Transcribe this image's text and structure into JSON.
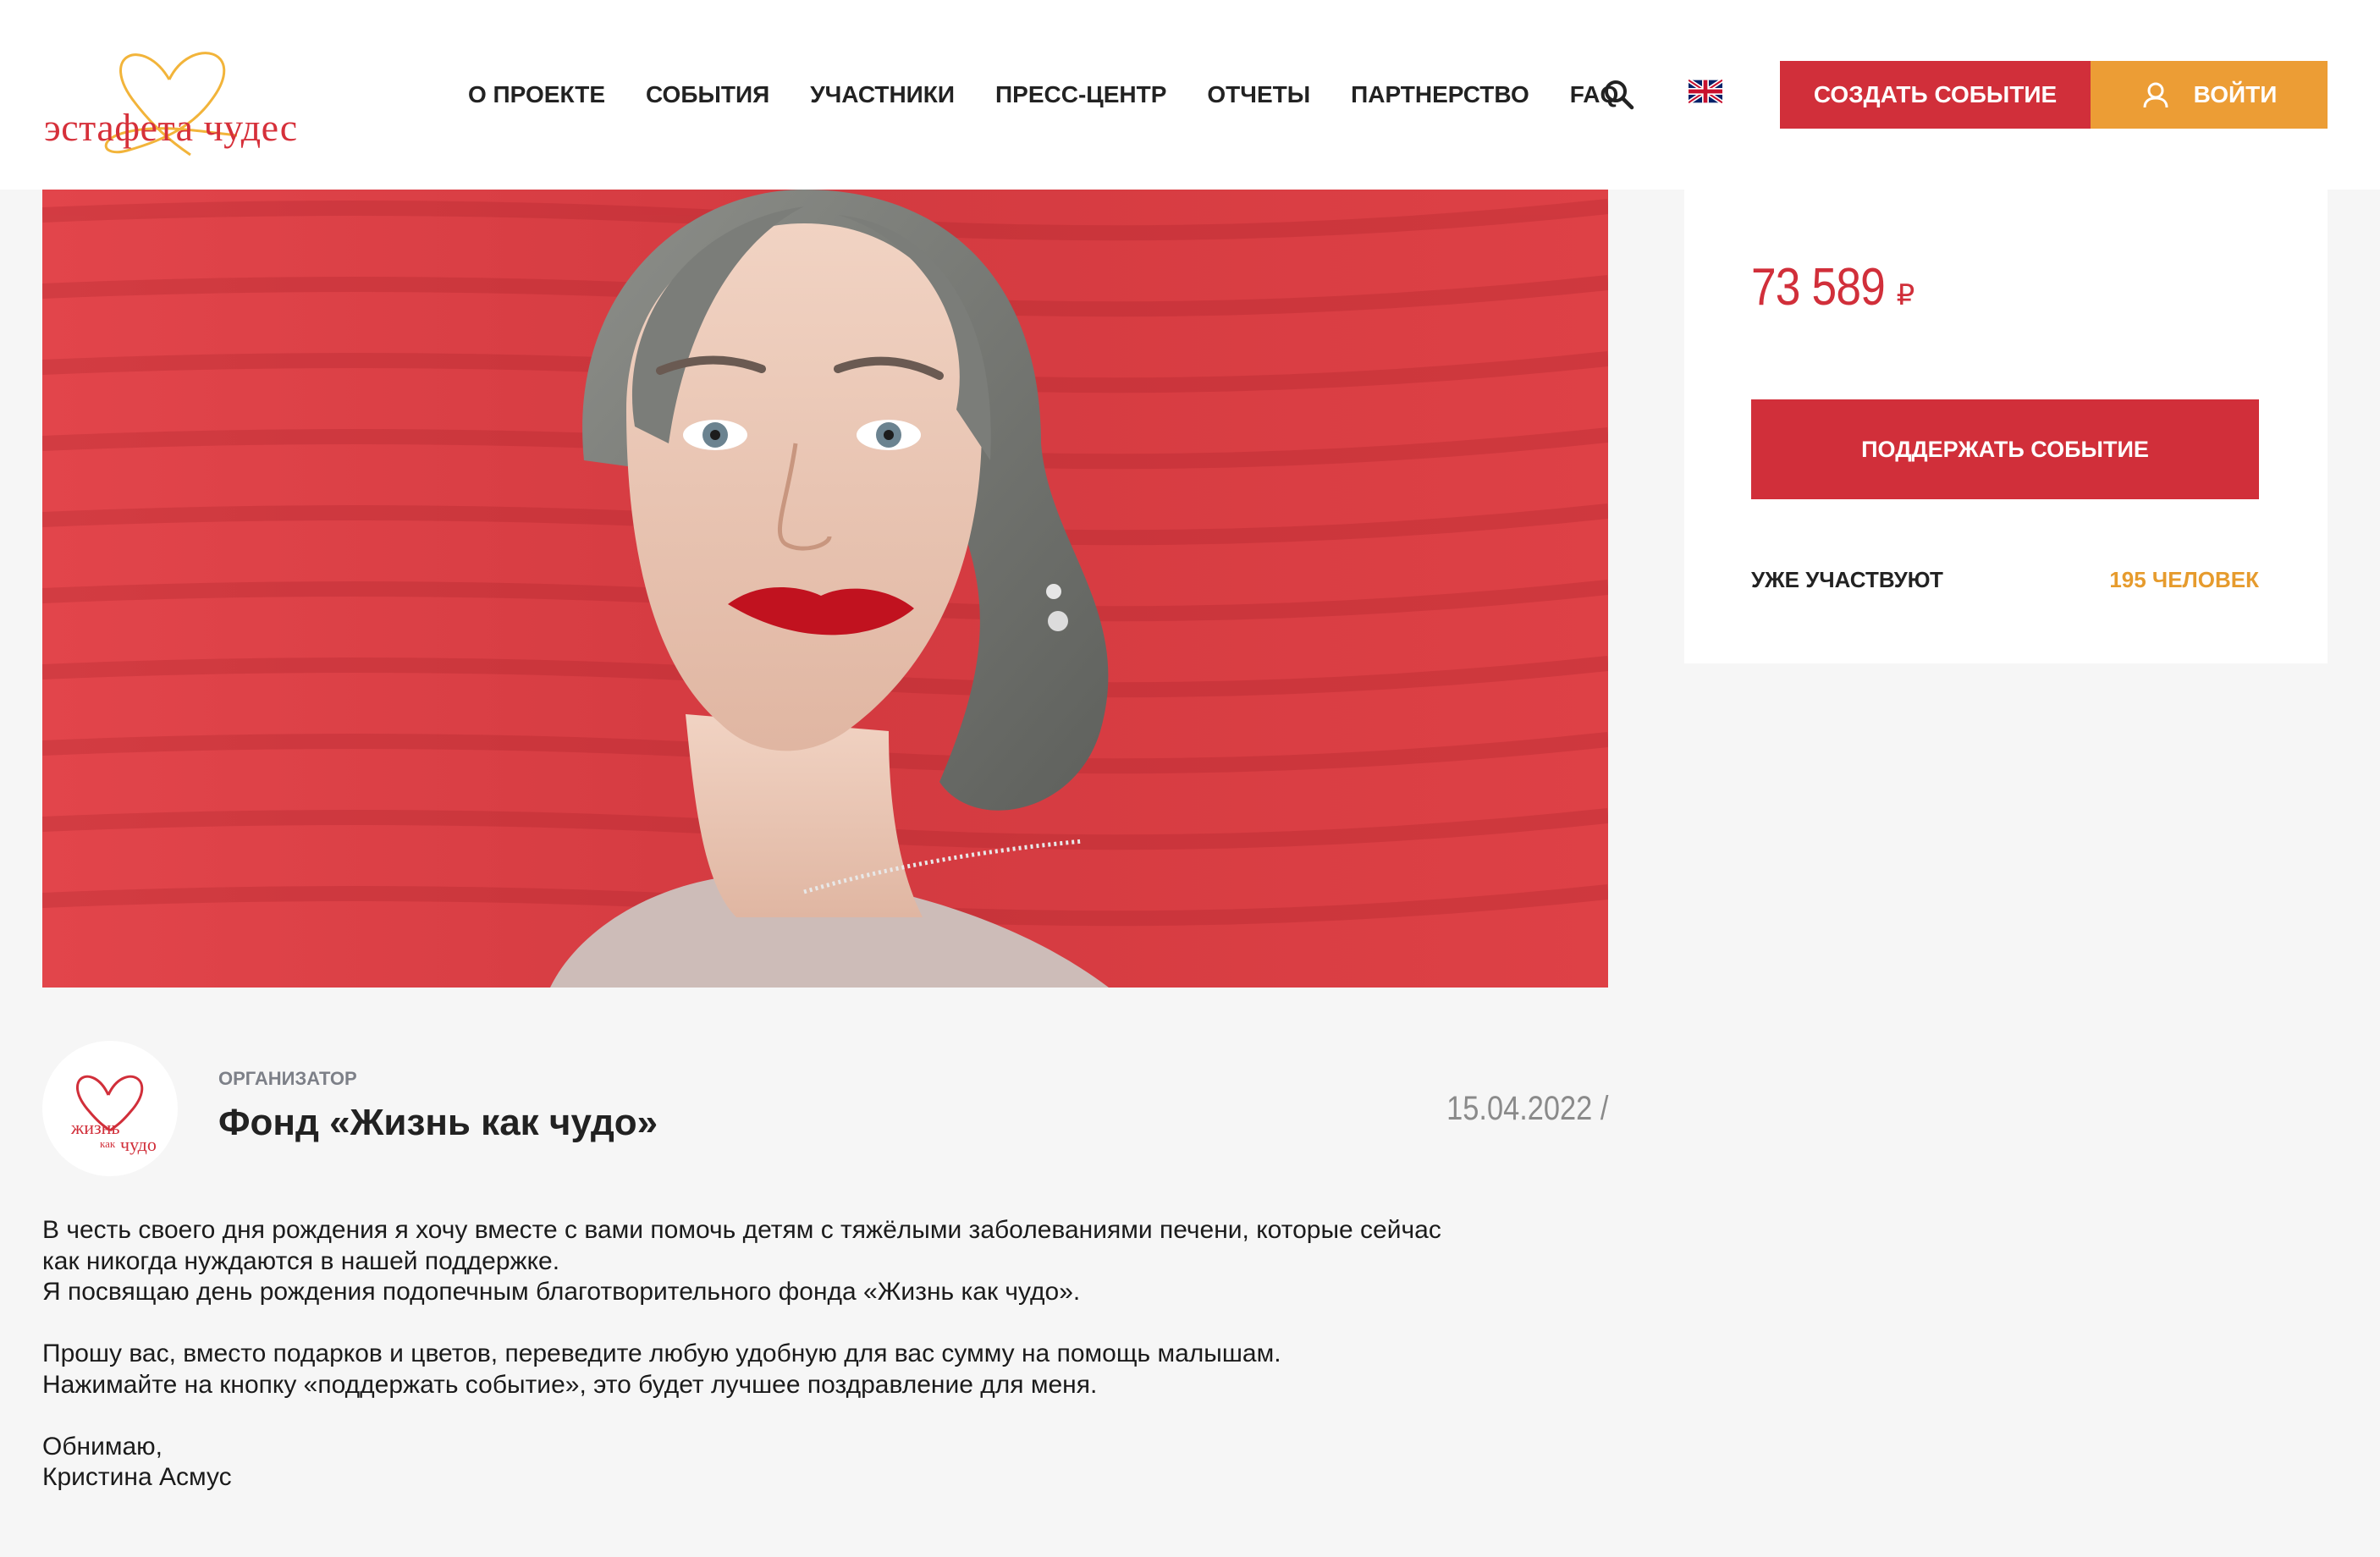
{
  "header": {
    "logo_text": "эстафета чудес",
    "nav": [
      "О проекте",
      "События",
      "Участники",
      "Пресс-центр",
      "Отчеты",
      "Партнерство",
      "FAQ"
    ],
    "search_icon": "search-icon",
    "language_icon": "uk-flag-icon",
    "create_event_label": "Создать событие",
    "login_label": "Войти",
    "login_icon": "user-icon"
  },
  "colors": {
    "brand_red": "#d12f3a",
    "accent_orange": "#ec9d35",
    "participants_orange": "#e69b2d"
  },
  "hero": {
    "image": "event-photo"
  },
  "panel": {
    "amount": "73 589",
    "currency": "₽",
    "support_button": "Поддержать событие",
    "participants_label": "Уже участвуют",
    "participants_count": "195 человек"
  },
  "organizer": {
    "label": "Организатор",
    "name": "Фонд «Жизнь как чудо»",
    "avatar_text": "жизнь как чудо",
    "date": "15.04.2022 /"
  },
  "description": {
    "paragraphs": [
      [
        "В честь своего дня рождения я хочу вместе с вами помочь детям с тяжёлыми заболеваниями печени, которые сейчас",
        "как никогда нуждаются в нашей поддержке.",
        "Я посвящаю день рождения подопечным благотворительного фонда «Жизнь как чудо»."
      ],
      [
        "Прошу вас, вместо подарков и цветов, переведите любую удобную для вас сумму на помощь малышам.",
        "Нажимайте на кнопку «поддержать событие», это будет лучшее поздравление для меня."
      ],
      [
        "Обнимаю,",
        "Кристина Асмус"
      ]
    ]
  }
}
